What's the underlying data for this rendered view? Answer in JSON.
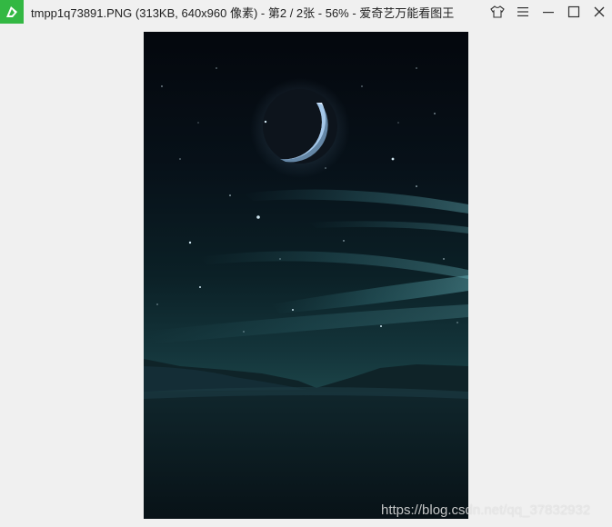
{
  "window": {
    "title": "tmpp1q73891.PNG (313KB, 640x960 像素) - 第2 / 2张 - 56% - 爱奇艺万能看图王"
  },
  "icons": {
    "app": "app-logo-icon",
    "skin": "shirt-icon",
    "menu": "menu-icon",
    "minimize": "minimize-icon",
    "maximize": "maximize-icon",
    "close": "close-icon"
  },
  "colors": {
    "brand": "#33b843",
    "background": "#f0f0f0",
    "sky_top": "#05090f",
    "sky_mid": "#0f2a30",
    "ground": "#0a171d"
  },
  "watermark": {
    "text": "https://blog.csdn.net/qq_37832932"
  }
}
